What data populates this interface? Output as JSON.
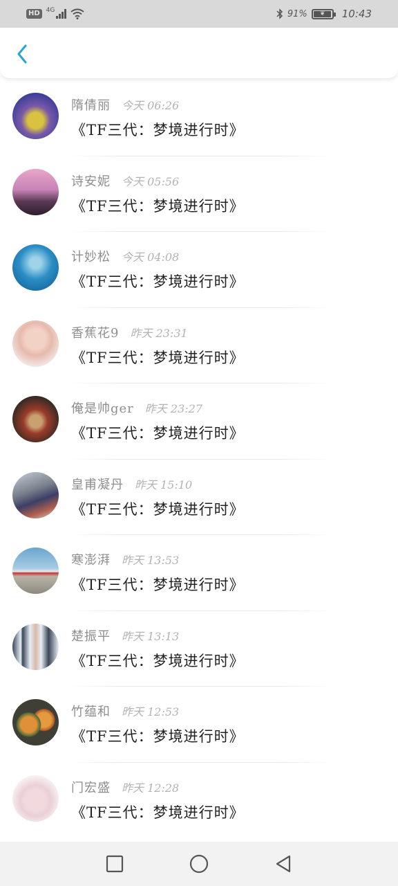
{
  "status_bar": {
    "hd_label": "HD",
    "network": "4G",
    "battery_percent": "91%",
    "time": "10:43"
  },
  "messages": [
    {
      "name": "隋倩丽",
      "day": "今天",
      "time": "06:26",
      "text": "《TF三代：梦境进行时》"
    },
    {
      "name": "诗安妮",
      "day": "今天",
      "time": "05:56",
      "text": "《TF三代：梦境进行时》"
    },
    {
      "name": "计妙松",
      "day": "今天",
      "time": "04:08",
      "text": "《TF三代：梦境进行时》"
    },
    {
      "name": "香蕉花9",
      "day": "昨天",
      "time": "23:31",
      "text": "《TF三代：梦境进行时》"
    },
    {
      "name": "俺是帅ger",
      "day": "昨天",
      "time": "23:27",
      "text": "《TF三代：梦境进行时》"
    },
    {
      "name": "皇甫凝丹",
      "day": "昨天",
      "time": "15:10",
      "text": "《TF三代：梦境进行时》"
    },
    {
      "name": "寒澎湃",
      "day": "昨天",
      "time": "13:53",
      "text": "《TF三代：梦境进行时》"
    },
    {
      "name": "楚振平",
      "day": "昨天",
      "time": "13:13",
      "text": "《TF三代：梦境进行时》"
    },
    {
      "name": "竹蕴和",
      "day": "昨天",
      "time": "12:53",
      "text": "《TF三代：梦境进行时》"
    },
    {
      "name": "门宏盛",
      "day": "昨天",
      "time": "12:28",
      "text": "《TF三代：梦境进行时》"
    }
  ],
  "colors": {
    "accent": "#2ba3d8",
    "status_bar_bg": "#d9d9d9",
    "nav_bar_bg": "#f2f2f2"
  }
}
